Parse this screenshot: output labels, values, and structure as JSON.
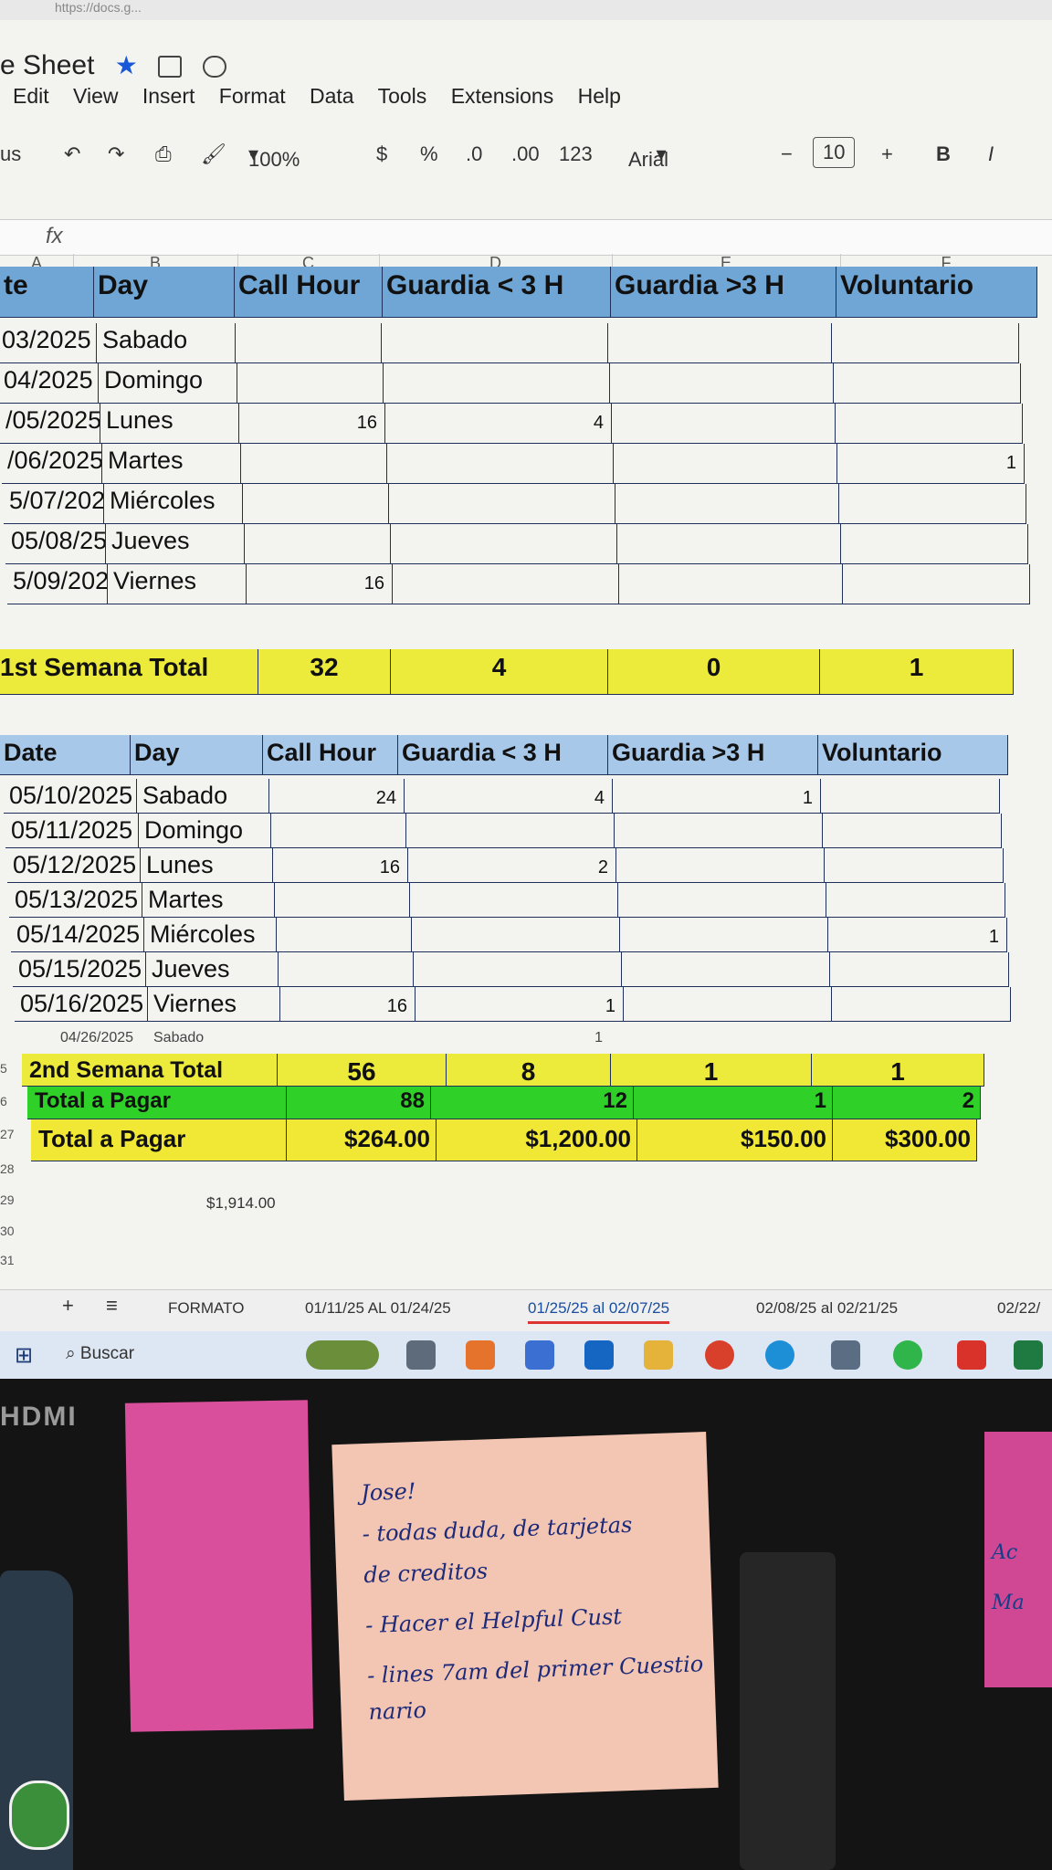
{
  "window": {
    "url": "https://docs.g...",
    "title": "e Sheet",
    "menu": [
      "Edit",
      "View",
      "Insert",
      "Format",
      "Data",
      "Tools",
      "Extensions",
      "Help"
    ]
  },
  "toolbar": {
    "menus_label": "us",
    "zoom": "100%",
    "currency": "$",
    "percent": "%",
    "dec_less": ".0",
    "dec_more": ".00",
    "number_format": "123",
    "font": "Arial",
    "font_size": "10",
    "minus": "−",
    "plus": "+",
    "bold": "B",
    "italic": "I"
  },
  "formula_bar": {
    "fx": "fx"
  },
  "columns": [
    "A",
    "B",
    "C",
    "D",
    "E",
    "F"
  ],
  "week1": {
    "headers": [
      "te",
      "Day",
      "Call Hour",
      "Guardia < 3 H",
      "Guardia >3 H",
      "Voluntario"
    ],
    "rows": [
      [
        "03/2025",
        "Sabado",
        "",
        "",
        "",
        ""
      ],
      [
        "04/2025",
        "Domingo",
        "",
        "",
        "",
        ""
      ],
      [
        "/05/2025",
        "Lunes",
        "16",
        "4",
        "",
        ""
      ],
      [
        "/06/2025",
        "Martes",
        "",
        "",
        "",
        "1"
      ],
      [
        "5/07/2025",
        "Miércoles",
        "",
        "",
        "",
        ""
      ],
      [
        "05/08/25",
        "Jueves",
        "",
        "",
        "",
        ""
      ],
      [
        "5/09/2025",
        "Viernes",
        "16",
        "",
        "",
        ""
      ]
    ],
    "total_label": "1st Semana Total",
    "totals": [
      "32",
      "4",
      "0",
      "1"
    ]
  },
  "week2": {
    "headers": [
      "Date",
      "Day",
      "Call Hour",
      "Guardia < 3 H",
      "Guardia >3 H",
      "Voluntario"
    ],
    "rows": [
      [
        "05/10/2025",
        "Sabado",
        "24",
        "4",
        "1",
        ""
      ],
      [
        "05/11/2025",
        "Domingo",
        "",
        "",
        "",
        ""
      ],
      [
        "05/12/2025",
        "Lunes",
        "16",
        "2",
        "",
        ""
      ],
      [
        "05/13/2025",
        "Martes",
        "",
        "",
        "",
        ""
      ],
      [
        "05/14/2025",
        "Miércoles",
        "",
        "",
        "",
        "1"
      ],
      [
        "05/15/2025",
        "Jueves",
        "",
        "",
        "",
        ""
      ],
      [
        "05/16/2025",
        "Viernes",
        "16",
        "1",
        "",
        ""
      ]
    ],
    "extra_row": [
      "04/26/2025",
      "Sabado",
      "",
      "1",
      "",
      ""
    ],
    "total_label": "2nd Semana Total",
    "totals": [
      "56",
      "8",
      "1",
      "1"
    ]
  },
  "pay_hours": {
    "label": "Total a Pagar",
    "values": [
      "88",
      "12",
      "1",
      "2"
    ]
  },
  "pay_amount": {
    "label": "Total a Pagar",
    "values": [
      "$264.00",
      "$1,200.00",
      "$150.00",
      "$300.00"
    ]
  },
  "grand_total": "$1,914.00",
  "row_numbers": [
    "5",
    "6",
    "27",
    "28",
    "29",
    "30",
    "31"
  ],
  "sheet_tabs": {
    "add": "+",
    "list": "≡",
    "tabs": [
      "FORMATO",
      "01/11/25 AL 01/24/25",
      "01/25/25 al 02/07/25",
      "02/08/25 al 02/21/25",
      "02/22/"
    ]
  },
  "taskbar": {
    "search": "Buscar"
  },
  "desk": {
    "hdmi": "HDMI",
    "note_lines": [
      "Jose!",
      "- todas duda, de tarjetas",
      "de creditos",
      "- Hacer el Helpful Cust",
      "- lines 7am del primer Cuestio",
      "nario"
    ],
    "right_note": [
      "Ac",
      "Ma"
    ]
  }
}
